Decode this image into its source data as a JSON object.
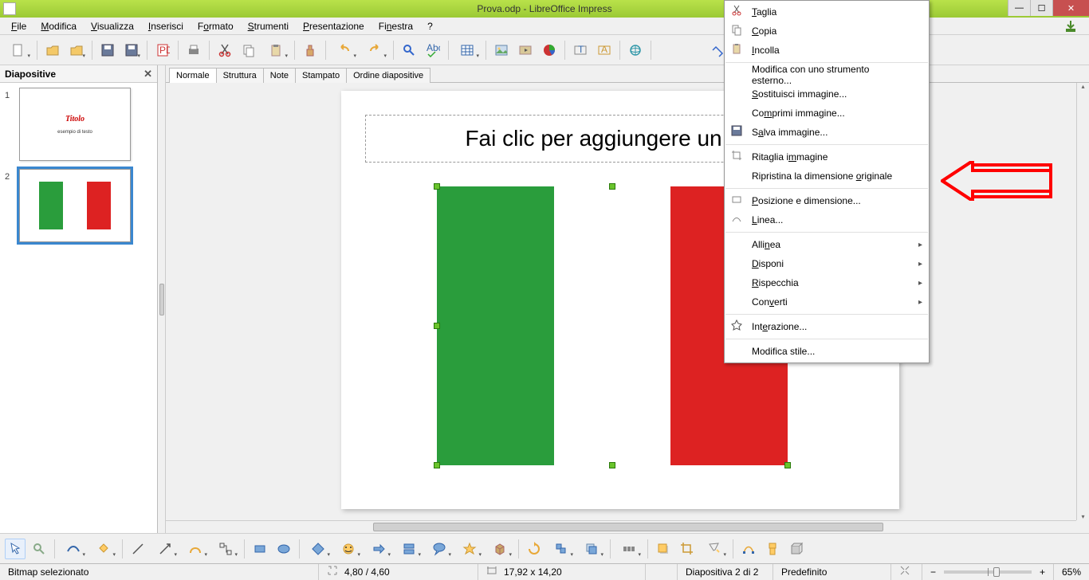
{
  "window": {
    "title": "Prova.odp - LibreOffice Impress"
  },
  "menu": {
    "file": "File",
    "modifica": "Modifica",
    "visualizza": "Visualizza",
    "inserisci": "Inserisci",
    "formato": "Formato",
    "strumenti": "Strumenti",
    "presentazione": "Presentazione",
    "finestra": "Finestra",
    "aiuto": "?"
  },
  "slide_panel": {
    "title": "Diapositive"
  },
  "slides": [
    {
      "num": "1",
      "title": "Titolo",
      "subtitle": "esempio di testo"
    },
    {
      "num": "2",
      "title": "",
      "subtitle": ""
    }
  ],
  "view_tabs": {
    "normale": "Normale",
    "struttura": "Struttura",
    "note": "Note",
    "stampato": "Stampato",
    "ordine": "Ordine diapositive"
  },
  "canvas": {
    "title_placeholder": "Fai clic per aggiungere un titolo"
  },
  "context_menu": {
    "taglia": "Taglia",
    "copia": "Copia",
    "incolla": "Incolla",
    "modifica_esterno": "Modifica con uno strumento esterno...",
    "sostituisci": "Sostituisci immagine...",
    "comprimi": "Comprimi immagine...",
    "salva": "Salva immagine...",
    "ritaglia": "Ritaglia immagine",
    "ripristina": "Ripristina la dimensione originale",
    "posizione": "Posizione e dimensione...",
    "linea": "Linea...",
    "allinea": "Allinea",
    "disponi": "Disponi",
    "rispecchia": "Rispecchia",
    "converti": "Converti",
    "interazione": "Interazione...",
    "modifica_stile": "Modifica stile..."
  },
  "status": {
    "selection": "Bitmap selezionato",
    "pos": "4,80 / 4,60",
    "size": "17,92 x 14,20",
    "slide_info": "Diapositiva 2 di 2",
    "master": "Predefinito",
    "zoom": "65%"
  }
}
